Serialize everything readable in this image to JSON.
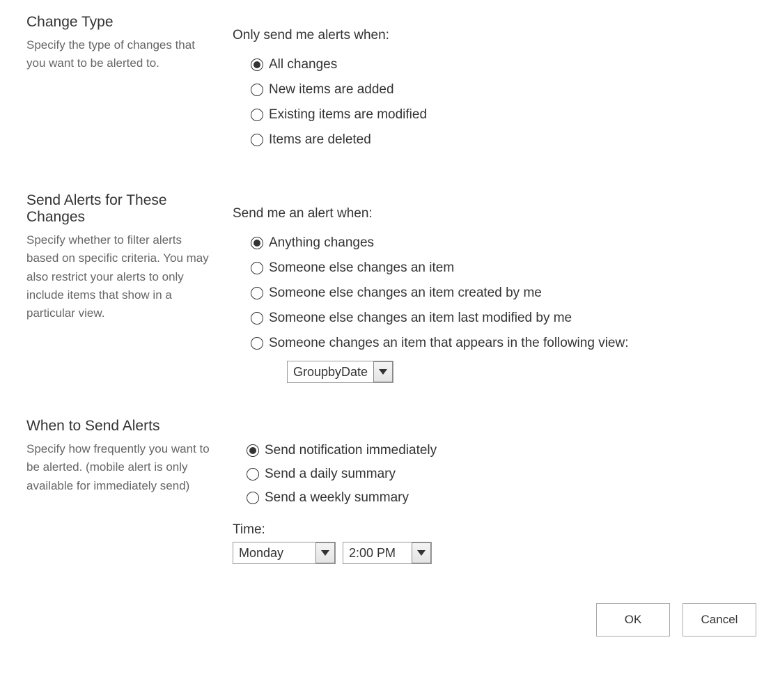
{
  "sections": {
    "changeType": {
      "title": "Change Type",
      "desc": "Specify the type of changes that you want to be alerted to.",
      "prompt": "Only send me alerts when:",
      "options": [
        {
          "label": "All changes",
          "selected": true
        },
        {
          "label": "New items are added",
          "selected": false
        },
        {
          "label": "Existing items are modified",
          "selected": false
        },
        {
          "label": "Items are deleted",
          "selected": false
        }
      ]
    },
    "sendForChanges": {
      "title": "Send Alerts for These Changes",
      "desc": "Specify whether to filter alerts based on specific criteria. You may also restrict your alerts to only include items that show in a particular view.",
      "prompt": "Send me an alert when:",
      "options": [
        {
          "label": "Anything changes",
          "selected": true
        },
        {
          "label": "Someone else changes an item",
          "selected": false
        },
        {
          "label": "Someone else changes an item created by me",
          "selected": false
        },
        {
          "label": "Someone else changes an item last modified by me",
          "selected": false
        },
        {
          "label": "Someone changes an item that appears in the following view:",
          "selected": false
        }
      ],
      "viewSelect": "GroupbyDate"
    },
    "whenToSend": {
      "title": "When to Send Alerts",
      "desc": "Specify how frequently you want to be alerted. (mobile alert is only available for immediately send)",
      "options": [
        {
          "label": "Send notification immediately",
          "selected": true
        },
        {
          "label": "Send a daily summary",
          "selected": false
        },
        {
          "label": "Send a weekly summary",
          "selected": false
        }
      ],
      "timeLabel": "Time:",
      "daySelect": "Monday",
      "timeSelect": "2:00 PM"
    }
  },
  "buttons": {
    "ok": "OK",
    "cancel": "Cancel"
  }
}
